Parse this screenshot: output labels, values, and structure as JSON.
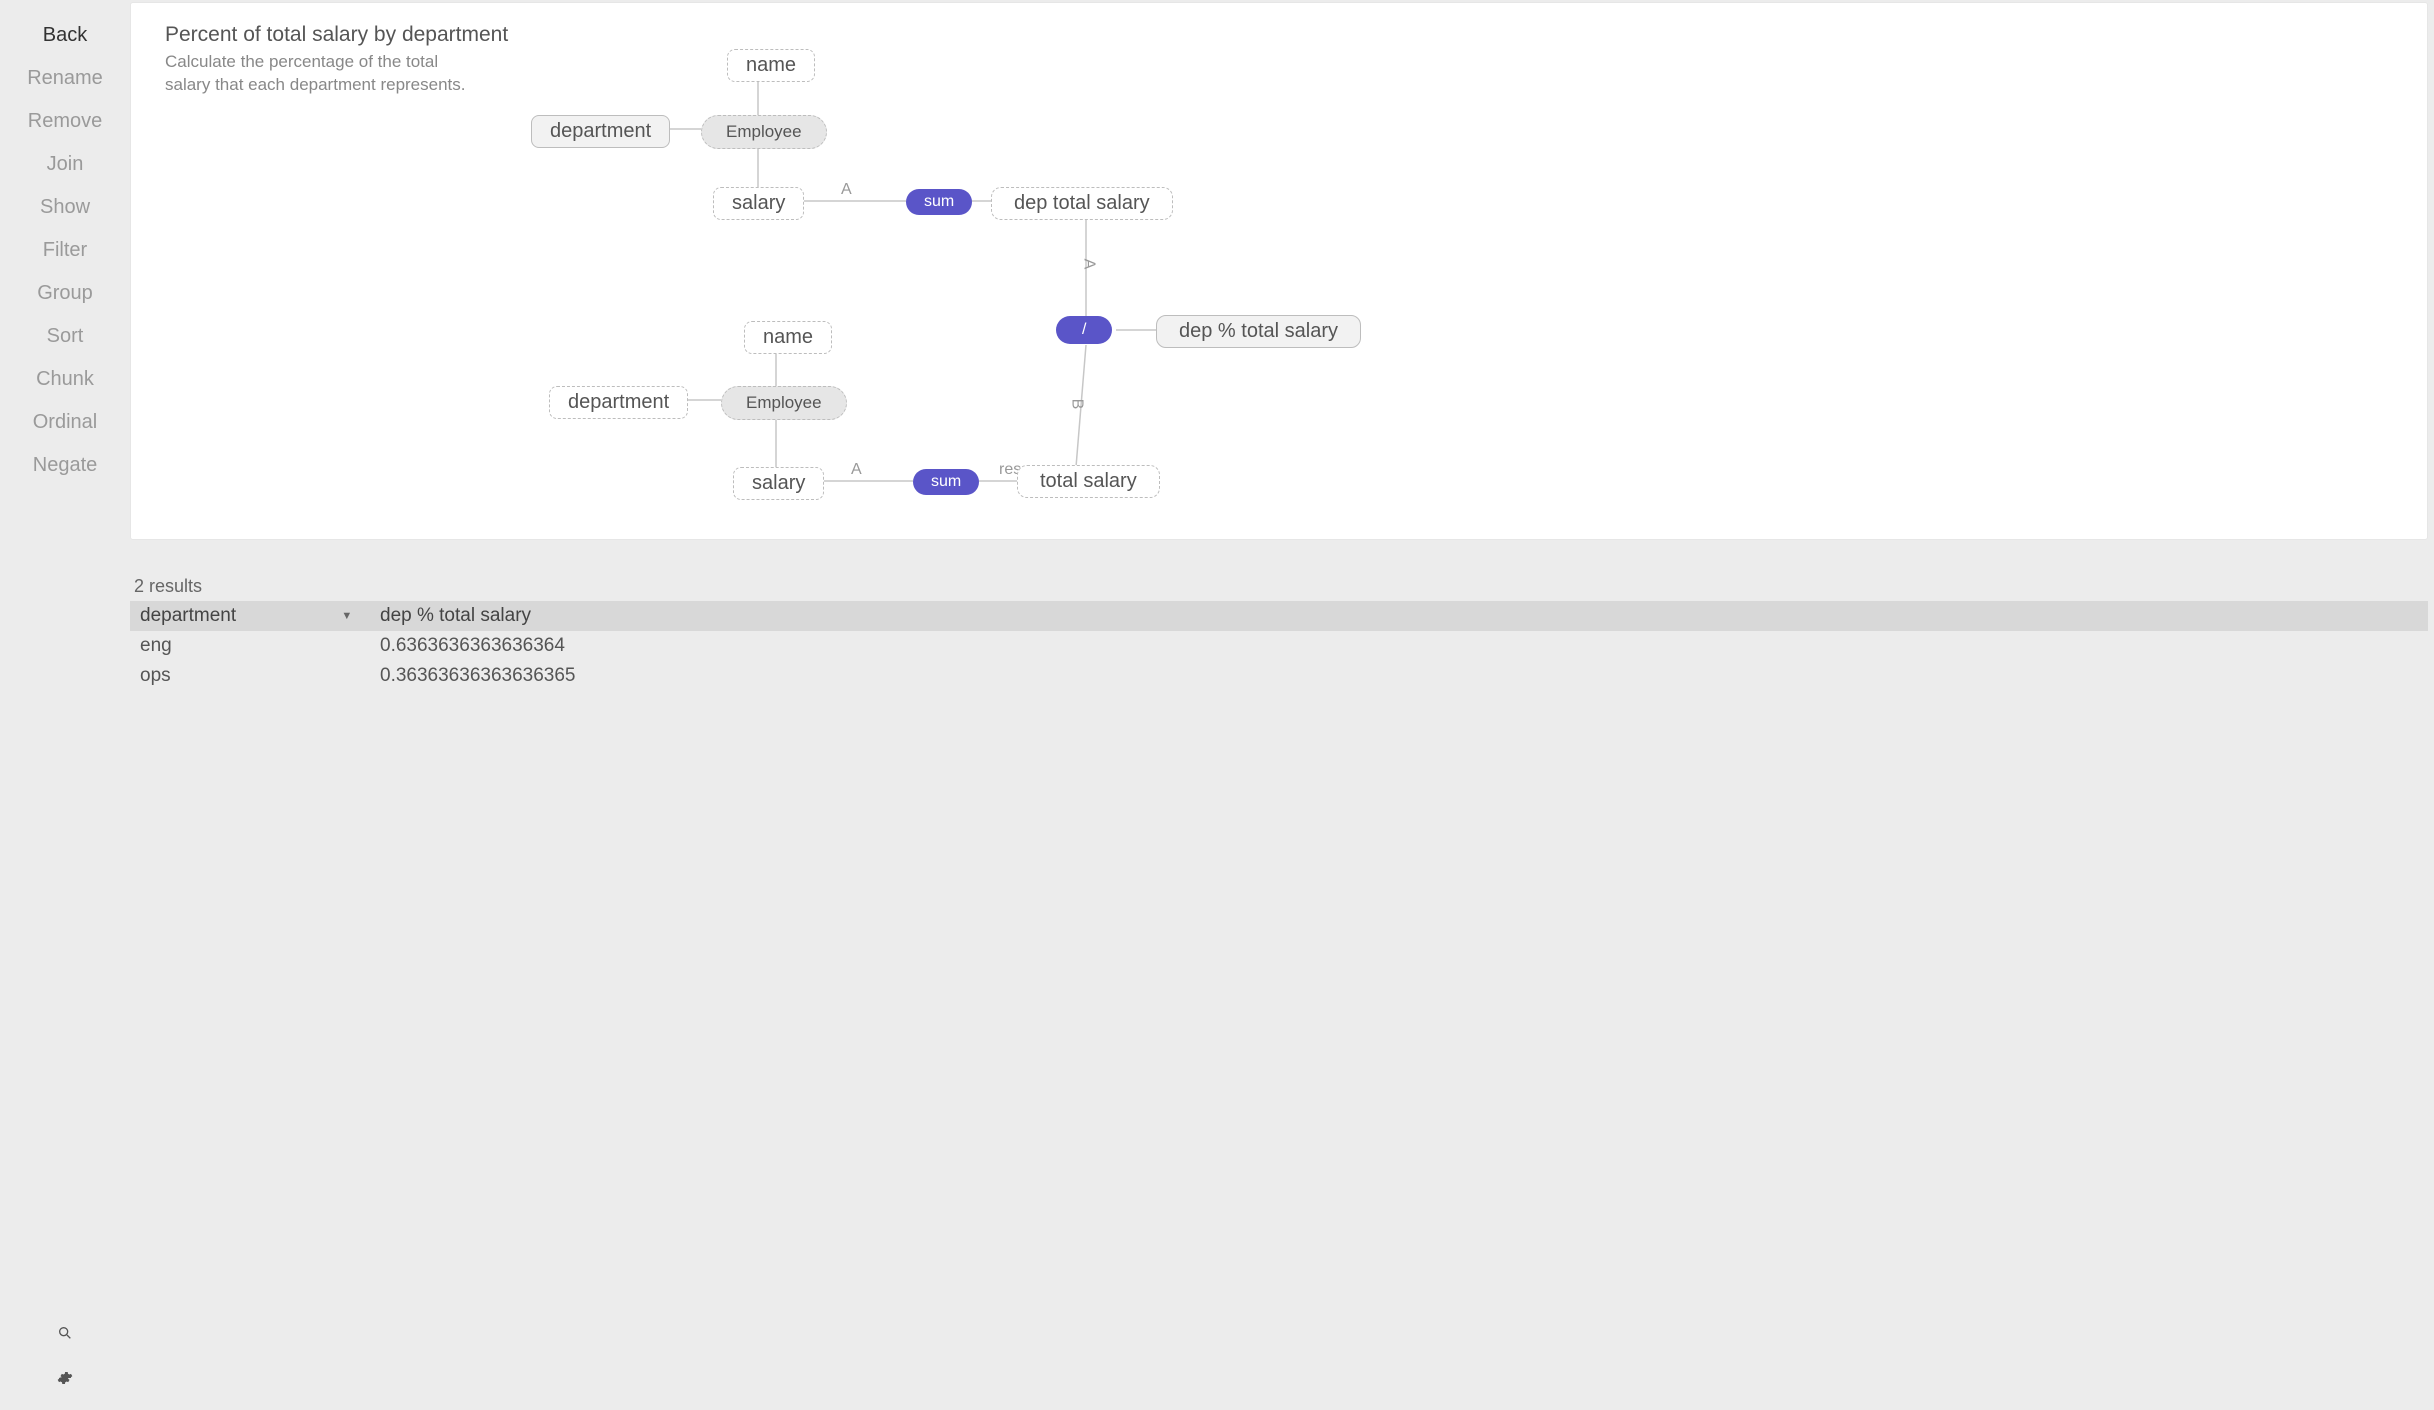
{
  "sidebar": {
    "items": [
      {
        "label": "Back",
        "active": true
      },
      {
        "label": "Rename",
        "active": false
      },
      {
        "label": "Remove",
        "active": false
      },
      {
        "label": "Join",
        "active": false
      },
      {
        "label": "Show",
        "active": false
      },
      {
        "label": "Filter",
        "active": false
      },
      {
        "label": "Group",
        "active": false
      },
      {
        "label": "Sort",
        "active": false
      },
      {
        "label": "Chunk",
        "active": false
      },
      {
        "label": "Ordinal",
        "active": false
      },
      {
        "label": "Negate",
        "active": false
      }
    ]
  },
  "canvas": {
    "title": "Percent of total salary by department",
    "description": "Calculate the percentage of the total salary that each department represents."
  },
  "diagram": {
    "groups": [
      {
        "entity": "Employee",
        "name": "name",
        "department": "department",
        "salary": "salary",
        "edge_label_A": "A",
        "sum_op": "sum",
        "result": "dep total salary",
        "grouping": true
      },
      {
        "entity": "Employee",
        "name": "name",
        "department": "department",
        "salary": "salary",
        "edge_label_A": "A",
        "edge_label_res": "res",
        "sum_op": "sum",
        "result": "total salary",
        "grouping": false
      }
    ],
    "divide": {
      "op": "/",
      "edge_label_A": "A",
      "edge_label_B": "B",
      "result": "dep % total salary"
    }
  },
  "results": {
    "count_label": "2 results",
    "columns": [
      "department",
      "dep % total salary"
    ],
    "rows": [
      {
        "department": "eng",
        "pct": "0.6363636363636364"
      },
      {
        "department": "ops",
        "pct": "0.36363636363636365"
      }
    ]
  }
}
